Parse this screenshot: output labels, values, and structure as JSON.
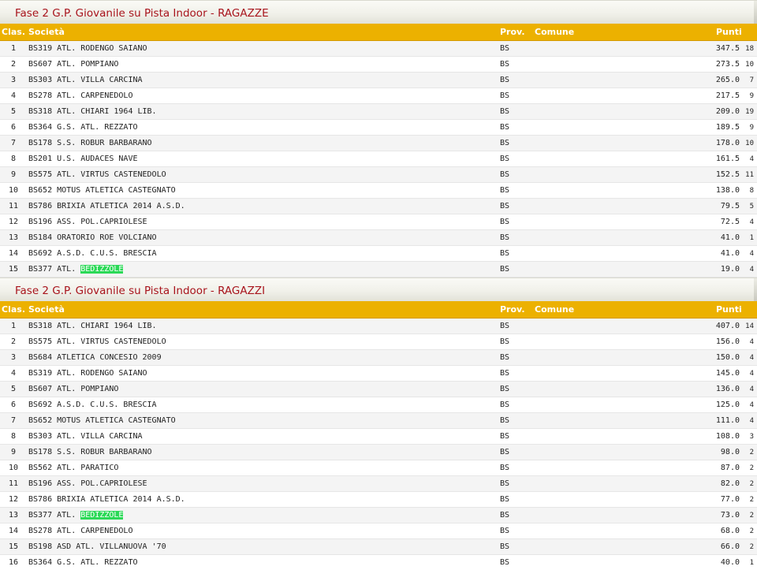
{
  "sections": [
    {
      "title": "Fase 2 G.P. Giovanile su Pista Indoor - RAGAZZE",
      "headers": {
        "clas": "Clas.",
        "societa": "Società",
        "prov": "Prov.",
        "comune": "Comune",
        "punti": "Punti"
      },
      "rows": [
        {
          "clas": "1",
          "code": "BS319",
          "name": "ATL. RODENGO SAIANO",
          "hl": "",
          "prov": "BS",
          "comune": "",
          "punti": "347.5",
          "n": "18"
        },
        {
          "clas": "2",
          "code": "BS607",
          "name": "ATL. POMPIANO",
          "hl": "",
          "prov": "BS",
          "comune": "",
          "punti": "273.5",
          "n": "10"
        },
        {
          "clas": "3",
          "code": "BS303",
          "name": "ATL. VILLA CARCINA",
          "hl": "",
          "prov": "BS",
          "comune": "",
          "punti": "265.0",
          "n": "7"
        },
        {
          "clas": "4",
          "code": "BS278",
          "name": "ATL. CARPENEDOLO",
          "hl": "",
          "prov": "BS",
          "comune": "",
          "punti": "217.5",
          "n": "9"
        },
        {
          "clas": "5",
          "code": "BS318",
          "name": "ATL. CHIARI 1964 LIB.",
          "hl": "",
          "prov": "BS",
          "comune": "",
          "punti": "209.0",
          "n": "19"
        },
        {
          "clas": "6",
          "code": "BS364",
          "name": "G.S. ATL. REZZATO",
          "hl": "",
          "prov": "BS",
          "comune": "",
          "punti": "189.5",
          "n": "9"
        },
        {
          "clas": "7",
          "code": "BS178",
          "name": "S.S. ROBUR BARBARANO",
          "hl": "",
          "prov": "BS",
          "comune": "",
          "punti": "178.0",
          "n": "10"
        },
        {
          "clas": "8",
          "code": "BS201",
          "name": "U.S. AUDACES NAVE",
          "hl": "",
          "prov": "BS",
          "comune": "",
          "punti": "161.5",
          "n": "4"
        },
        {
          "clas": "9",
          "code": "BS575",
          "name": "ATL. VIRTUS CASTENEDOLO",
          "hl": "",
          "prov": "BS",
          "comune": "",
          "punti": "152.5",
          "n": "11"
        },
        {
          "clas": "10",
          "code": "BS652",
          "name": "MOTUS ATLETICA CASTEGNATO",
          "hl": "",
          "prov": "BS",
          "comune": "",
          "punti": "138.0",
          "n": "8"
        },
        {
          "clas": "11",
          "code": "BS786",
          "name": "BRIXIA ATLETICA 2014 A.S.D.",
          "hl": "",
          "prov": "BS",
          "comune": "",
          "punti": "79.5",
          "n": "5"
        },
        {
          "clas": "12",
          "code": "BS196",
          "name": "ASS. POL.CAPRIOLESE",
          "hl": "",
          "prov": "BS",
          "comune": "",
          "punti": "72.5",
          "n": "4"
        },
        {
          "clas": "13",
          "code": "BS184",
          "name": "ORATORIO ROE VOLCIANO",
          "hl": "",
          "prov": "BS",
          "comune": "",
          "punti": "41.0",
          "n": "1"
        },
        {
          "clas": "14",
          "code": "BS692",
          "name": "A.S.D. C.U.S. BRESCIA",
          "hl": "",
          "prov": "BS",
          "comune": "",
          "punti": "41.0",
          "n": "4"
        },
        {
          "clas": "15",
          "code": "BS377",
          "name": "ATL.",
          "hl": "BEDIZZOLE",
          "prov": "BS",
          "comune": "",
          "punti": "19.0",
          "n": "4"
        }
      ]
    },
    {
      "title": "Fase 2 G.P. Giovanile su Pista Indoor - RAGAZZI",
      "headers": {
        "clas": "Clas.",
        "societa": "Società",
        "prov": "Prov.",
        "comune": "Comune",
        "punti": "Punti"
      },
      "rows": [
        {
          "clas": "1",
          "code": "BS318",
          "name": "ATL. CHIARI 1964 LIB.",
          "hl": "",
          "prov": "BS",
          "comune": "",
          "punti": "407.0",
          "n": "14"
        },
        {
          "clas": "2",
          "code": "BS575",
          "name": "ATL. VIRTUS CASTENEDOLO",
          "hl": "",
          "prov": "BS",
          "comune": "",
          "punti": "156.0",
          "n": "4"
        },
        {
          "clas": "3",
          "code": "BS684",
          "name": "ATLETICA CONCESIO 2009",
          "hl": "",
          "prov": "BS",
          "comune": "",
          "punti": "150.0",
          "n": "4"
        },
        {
          "clas": "4",
          "code": "BS319",
          "name": "ATL. RODENGO SAIANO",
          "hl": "",
          "prov": "BS",
          "comune": "",
          "punti": "145.0",
          "n": "4"
        },
        {
          "clas": "5",
          "code": "BS607",
          "name": "ATL. POMPIANO",
          "hl": "",
          "prov": "BS",
          "comune": "",
          "punti": "136.0",
          "n": "4"
        },
        {
          "clas": "6",
          "code": "BS692",
          "name": "A.S.D. C.U.S. BRESCIA",
          "hl": "",
          "prov": "BS",
          "comune": "",
          "punti": "125.0",
          "n": "4"
        },
        {
          "clas": "7",
          "code": "BS652",
          "name": "MOTUS ATLETICA CASTEGNATO",
          "hl": "",
          "prov": "BS",
          "comune": "",
          "punti": "111.0",
          "n": "4"
        },
        {
          "clas": "8",
          "code": "BS303",
          "name": "ATL. VILLA CARCINA",
          "hl": "",
          "prov": "BS",
          "comune": "",
          "punti": "108.0",
          "n": "3"
        },
        {
          "clas": "9",
          "code": "BS178",
          "name": "S.S. ROBUR BARBARANO",
          "hl": "",
          "prov": "BS",
          "comune": "",
          "punti": "98.0",
          "n": "2"
        },
        {
          "clas": "10",
          "code": "BS562",
          "name": "ATL. PARATICO",
          "hl": "",
          "prov": "BS",
          "comune": "",
          "punti": "87.0",
          "n": "2"
        },
        {
          "clas": "11",
          "code": "BS196",
          "name": "ASS. POL.CAPRIOLESE",
          "hl": "",
          "prov": "BS",
          "comune": "",
          "punti": "82.0",
          "n": "2"
        },
        {
          "clas": "12",
          "code": "BS786",
          "name": "BRIXIA ATLETICA 2014 A.S.D.",
          "hl": "",
          "prov": "BS",
          "comune": "",
          "punti": "77.0",
          "n": "2"
        },
        {
          "clas": "13",
          "code": "BS377",
          "name": "ATL.",
          "hl": "BEDIZZOLE",
          "prov": "BS",
          "comune": "",
          "punti": "73.0",
          "n": "2"
        },
        {
          "clas": "14",
          "code": "BS278",
          "name": "ATL. CARPENEDOLO",
          "hl": "",
          "prov": "BS",
          "comune": "",
          "punti": "68.0",
          "n": "2"
        },
        {
          "clas": "15",
          "code": "BS198",
          "name": "ASD ATL. VILLANUOVA '70",
          "hl": "",
          "prov": "BS",
          "comune": "",
          "punti": "66.0",
          "n": "2"
        },
        {
          "clas": "16",
          "code": "BS364",
          "name": "G.S. ATL. REZZATO",
          "hl": "",
          "prov": "BS",
          "comune": "",
          "punti": "40.0",
          "n": "1"
        }
      ]
    }
  ],
  "colors": {
    "title_text": "#a8141c",
    "header_bg": "#ecb100",
    "header_text": "#ffffff",
    "highlight_bg": "#2bd957",
    "row_alt_bg": "#f4f4f4"
  }
}
